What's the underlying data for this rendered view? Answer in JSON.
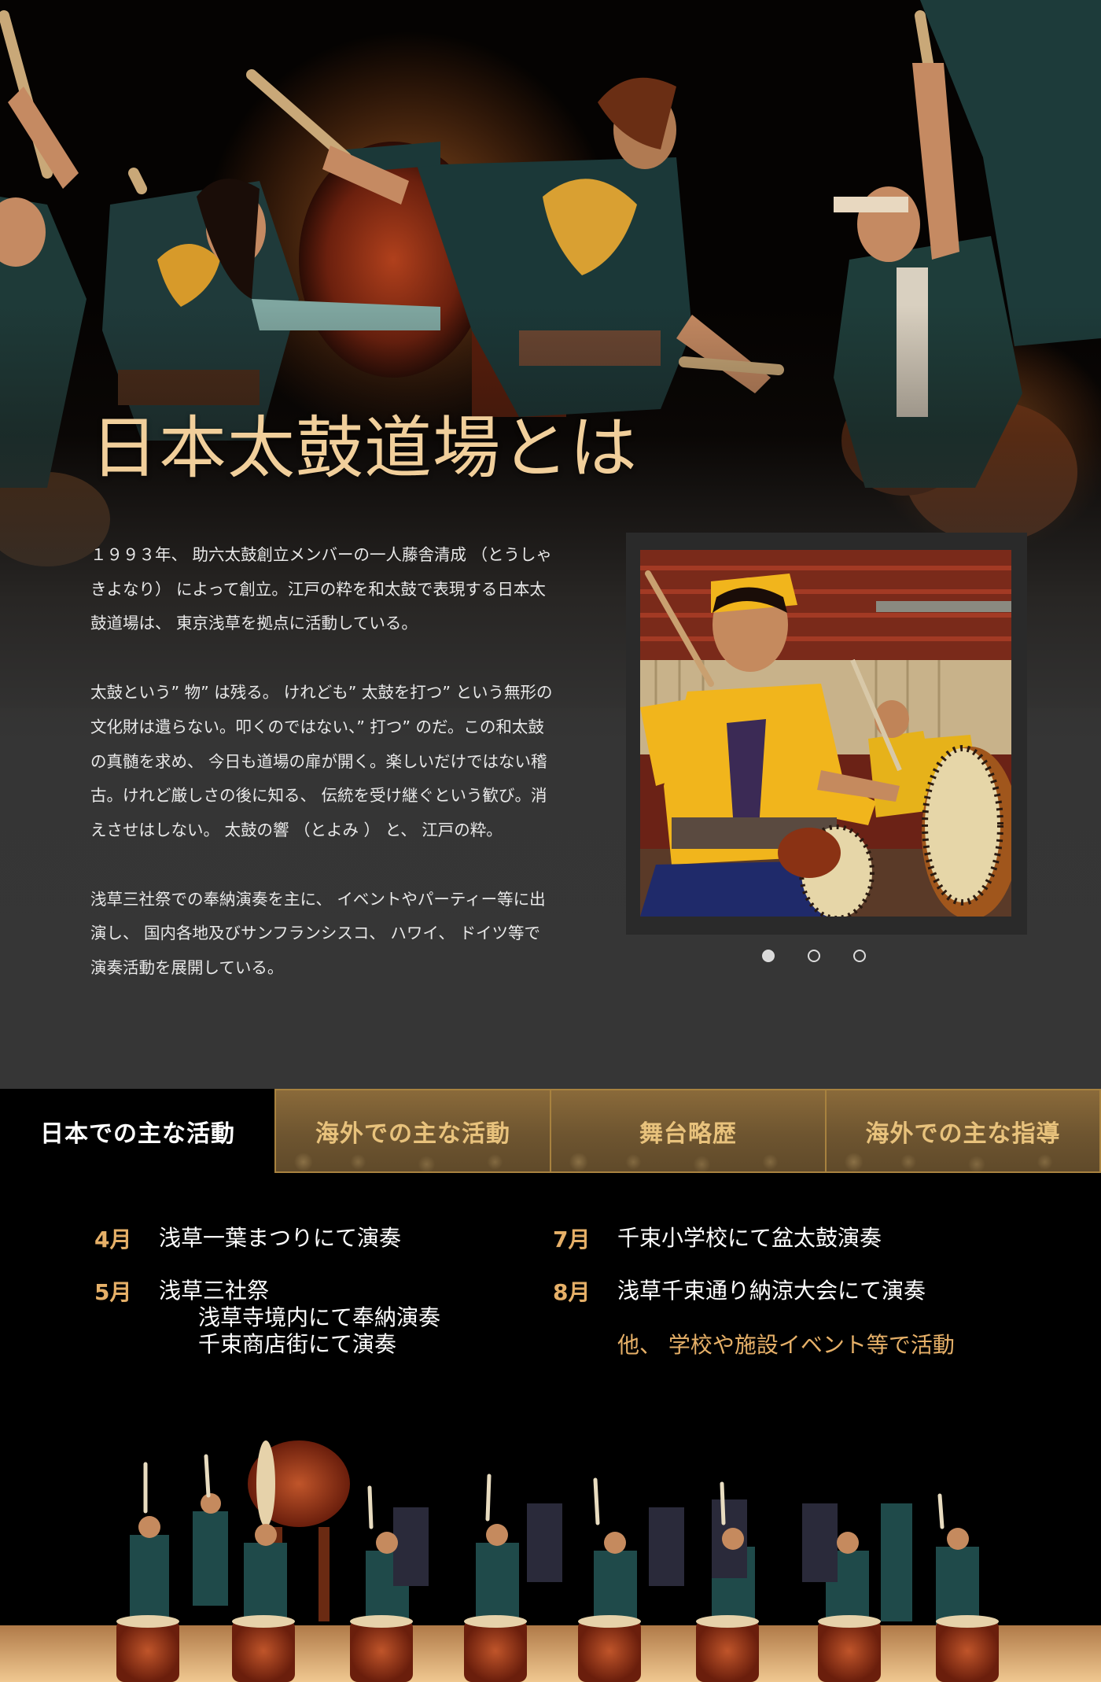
{
  "hero": {
    "title": "日本太鼓道場とは",
    "paragraphs": [
      "１９９３年、 助六太鼓創立メンバーの一人藤舎清成 （とうしゃきよなり） によって創立。江戸の粋を和太鼓で表現する日本太鼓道場は、 東京浅草を拠点に活動している。",
      "太鼓という” 物” は残る。 けれども” 太鼓を打つ” という無形の文化財は遺らない。叩くのではない、” 打つ” のだ。この和太鼓の真髄を求め、 今日も道場の扉が開く。楽しいだけではない稽古。けれど厳しさの後に知る、 伝統を受け継ぐという歓び。消えさせはしない。 太鼓の響 （とよみ ） と、 江戸の粋。",
      "浅草三社祭での奉納演奏を主に、 イベントやパーティー等に出演し、 国内各地及びサンフランシスコ、 ハワイ、 ドイツ等で演奏活動を展開している。"
    ]
  },
  "carousel": {
    "slide_count": 3,
    "active_index": 0
  },
  "tabs": [
    {
      "label": "日本での主な活動",
      "active": true
    },
    {
      "label": "海外での主な活動",
      "active": false
    },
    {
      "label": "舞台略歴",
      "active": false
    },
    {
      "label": "海外での主な指導",
      "active": false
    }
  ],
  "activities": {
    "left": [
      {
        "month": "4月",
        "lines": [
          "浅草一葉まつりにて演奏"
        ]
      },
      {
        "month": "5月",
        "lines": [
          "浅草三社祭",
          "浅草寺境内にて奉納演奏",
          "千束商店街にて演奏"
        ]
      }
    ],
    "right": [
      {
        "month": "7月",
        "lines": [
          "千束小学校にて盆太鼓演奏"
        ]
      },
      {
        "month": "8月",
        "lines": [
          "浅草千束通り納涼大会にて演奏"
        ]
      }
    ],
    "other": "他、 学校や施設イベント等で活動"
  },
  "colors": {
    "gold": "#f1cf9b",
    "accent": "#e6b068",
    "panel": "#363636",
    "tab_bg": "#6e5530",
    "tab_text": "#e8c27c"
  }
}
